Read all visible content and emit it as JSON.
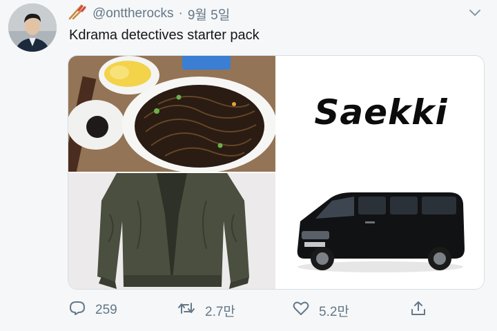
{
  "tweet": {
    "handle": "@onttherocks",
    "separator": "·",
    "date": "9월 5일",
    "text": "Kdrama detectives starter pack"
  },
  "media": {
    "caption_word": "Saekki"
  },
  "actions": {
    "reply_count": "259",
    "retweet_count": "2.7만",
    "like_count": "5.2만"
  },
  "icons": [
    "chopsticks-icon",
    "chevron-down-icon",
    "reply-icon",
    "retweet-icon",
    "like-icon",
    "share-icon"
  ],
  "colors": {
    "background": "#f5f7f9",
    "secondary_text": "#657786",
    "primary_text": "#14171a"
  }
}
